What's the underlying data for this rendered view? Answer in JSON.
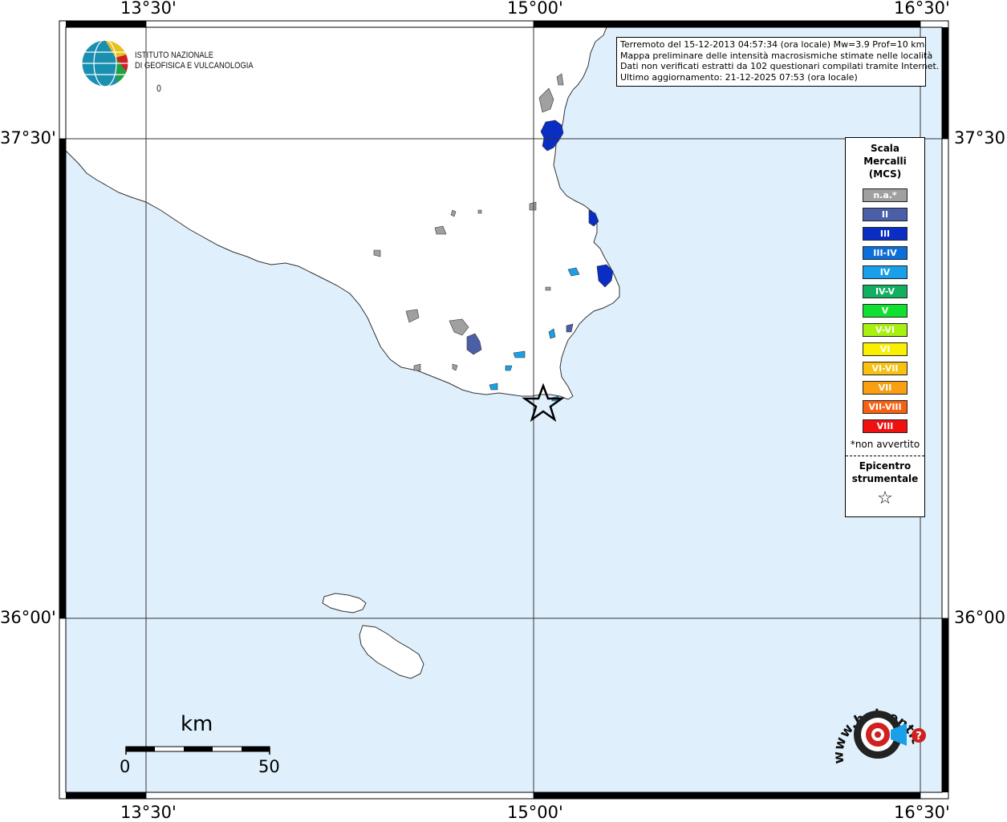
{
  "axes": {
    "lon_ticks": [
      "13°30'",
      "15°00'",
      "16°30'"
    ],
    "lat_ticks": [
      "37°30'",
      "36°00'"
    ]
  },
  "info": {
    "line1": "Terremoto del 15-12-2013 04:57:34 (ora locale) Mw=3.9 Prof=10 km",
    "line2": "Mappa preliminare delle intensità macrosismiche stimate nelle località",
    "line3": "Dati non verificati estratti da 102 questionari compilati tramite Internet.",
    "line4": "Ultimo aggiornamento: 21-12-2025 07:53 (ora locale)"
  },
  "logo": {
    "line1": "ISTITUTO NAZIONALE",
    "line2": "DI GEOFISICA E VULCANOLOGIA"
  },
  "legend": {
    "title1": "Scala",
    "title2": "Mercalli",
    "title3": "(MCS)",
    "classes": [
      {
        "label": "n.a.*",
        "color": "#a0a0a0"
      },
      {
        "label": "II",
        "color": "#4a5fa8"
      },
      {
        "label": "III",
        "color": "#0a2ec4"
      },
      {
        "label": "III-IV",
        "color": "#0a6fd8"
      },
      {
        "label": "IV",
        "color": "#1aa0e8"
      },
      {
        "label": "IV-V",
        "color": "#10b060"
      },
      {
        "label": "V",
        "color": "#10e030"
      },
      {
        "label": "V-VI",
        "color": "#a8f010"
      },
      {
        "label": "VI",
        "color": "#f8f000"
      },
      {
        "label": "VI-VII",
        "color": "#f8c010"
      },
      {
        "label": "VII",
        "color": "#f8a010"
      },
      {
        "label": "VII-VIII",
        "color": "#f86010"
      },
      {
        "label": "VIII",
        "color": "#f01010"
      }
    ],
    "note": "*non avvertito",
    "epi1": "Epicentro",
    "epi2": "strumentale",
    "star": "☆"
  },
  "scalebar": {
    "title": "km",
    "start": "0",
    "end": "50"
  },
  "watermark": {
    "text": "www.haisentitoilterremoto.it",
    "badge": "?"
  },
  "colors": {
    "sea": "#dff0fc",
    "land": "#ffffff",
    "coast": "#333333",
    "grid": "#333333"
  },
  "localities": [
    {
      "intensity": "III",
      "color": "#0a2ec4"
    },
    {
      "intensity": "III",
      "color": "#0a2ec4"
    },
    {
      "intensity": "III",
      "color": "#0a2ec4"
    },
    {
      "intensity": "II",
      "color": "#4a5fa8"
    },
    {
      "intensity": "II",
      "color": "#4a5fa8"
    },
    {
      "intensity": "IV",
      "color": "#1aa0e8"
    },
    {
      "intensity": "n.a.",
      "color": "#a0a0a0"
    }
  ]
}
